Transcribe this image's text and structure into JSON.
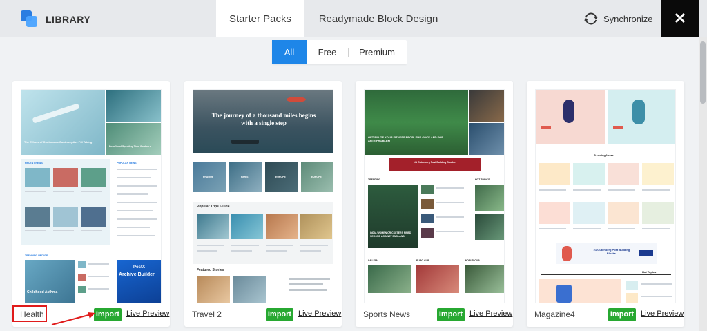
{
  "header": {
    "library_title": "LIBRARY",
    "tabs": [
      {
        "label": "Starter Packs",
        "active": true
      },
      {
        "label": "Readymade Block Design",
        "active": false
      }
    ],
    "sync_label": "Synchronize",
    "close_glyph": "✕"
  },
  "filter": {
    "all": "All",
    "free": "Free",
    "premium": "Premium",
    "selected": "All"
  },
  "cards": [
    {
      "name": "Health",
      "import_label": "Import",
      "preview_label": "Live Preview",
      "thumb_text": {
        "hero1": "The Effects of Continuous Contraceptive Pill Taking",
        "hero2": "Benefits of Speeding Time Outdoors",
        "recent": "RECENT NEWS",
        "popular": "POPULAR NEWS",
        "trending": "TRENDING UPDATE",
        "archive_top": "PostX",
        "archive_main": "Archive Builder",
        "childhood": "Childhood Asthma"
      }
    },
    {
      "name": "Travel 2",
      "import_label": "Import",
      "preview_label": "Live Preview",
      "thumb_text": {
        "hero": "The journey of a thousand miles begins with a single step",
        "cities": [
          "PRAGUE",
          "PARIS",
          "EUROPE",
          "EUROPE"
        ],
        "popular": "Popular Trips Guide",
        "featured": "Featured Stories"
      }
    },
    {
      "name": "Sports News",
      "import_label": "Import",
      "preview_label": "Live Preview",
      "thumb_text": {
        "hero": "GET RID OF YOUR FITNESS PROBLEMS ONCE AND FOR ANTE PROBLEM",
        "ad": "#1 Gutenberg Post Building Blocks.",
        "trending": "TRENDING",
        "hot": "HOT TOPICS",
        "story": "INDIA WOMEN CRICKETERS FINED SECOND AGAINST ENGLAND",
        "labels": [
          "LA LIGA",
          "EURO CUP",
          "WORLD CUP"
        ]
      }
    },
    {
      "name": "Magazine4",
      "import_label": "Import",
      "preview_label": "Live Preview",
      "thumb_text": {
        "trending": "Trending News",
        "ad": "#1 Gutenberg Post Building Blocks.",
        "hot": "Hot Topics"
      }
    }
  ],
  "colors": {
    "accent": "#1e86e8",
    "import_green": "#27a831",
    "highlight_red": "#e01b1b",
    "close_bg": "#0a0a0a"
  },
  "icons": [
    "library-logo-icon",
    "synchronize-icon",
    "close-icon",
    "annotation-arrow-icon"
  ]
}
